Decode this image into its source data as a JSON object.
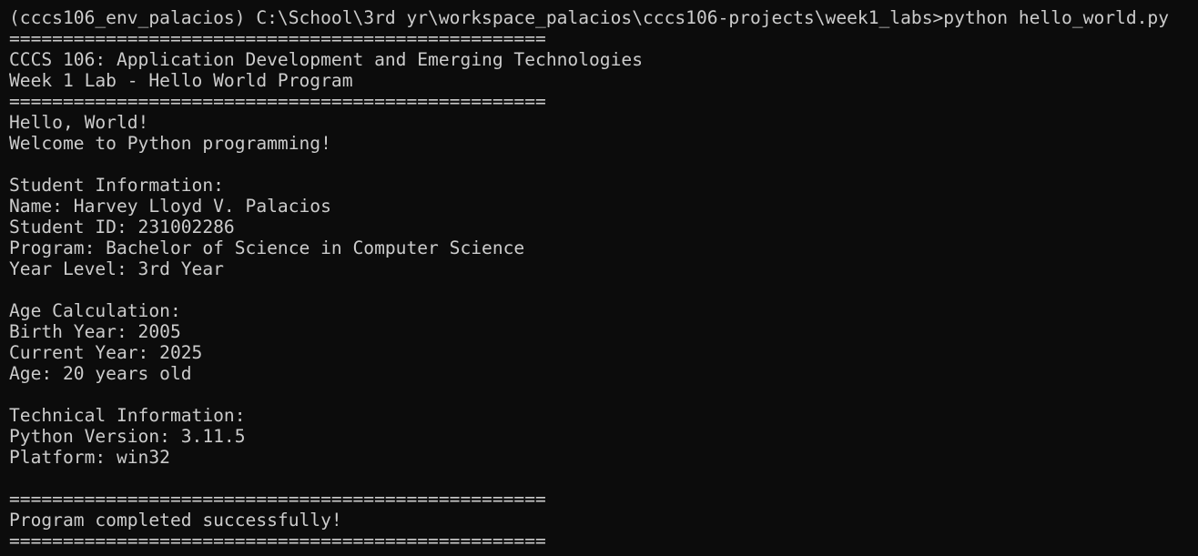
{
  "terminal": {
    "lines": [
      "(cccs106_env_palacios) C:\\School\\3rd yr\\workspace_palacios\\cccs106-projects\\week1_labs>python hello_world.py",
      "==================================================",
      "CCCS 106: Application Development and Emerging Technologies",
      "Week 1 Lab - Hello World Program",
      "==================================================",
      "Hello, World!",
      "Welcome to Python programming!",
      "",
      "Student Information:",
      "Name: Harvey Lloyd V. Palacios",
      "Student ID: 231002286",
      "Program: Bachelor of Science in Computer Science",
      "Year Level: 3rd Year",
      "",
      "Age Calculation:",
      "Birth Year: 2005",
      "Current Year: 2025",
      "Age: 20 years old",
      "",
      "Technical Information:",
      "Python Version: 3.11.5",
      "Platform: win32",
      "",
      "==================================================",
      "Program completed successfully!",
      "=================================================="
    ]
  },
  "colors": {
    "background": "#0c0c0c",
    "foreground": "#cccccc"
  }
}
